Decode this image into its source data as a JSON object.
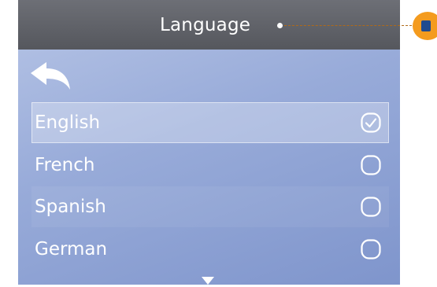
{
  "header": {
    "title": "Language"
  },
  "icons": {
    "back": "back-arrow-icon",
    "checked": "checked-circle-icon",
    "unchecked": "empty-circle-icon",
    "scroll": "scroll-down-triangle-icon"
  },
  "languages": [
    {
      "label": "English",
      "selected": true
    },
    {
      "label": "French",
      "selected": false
    },
    {
      "label": "Spanish",
      "selected": false
    },
    {
      "label": "German",
      "selected": false
    }
  ],
  "colors": {
    "header": "#5e6066",
    "screen_top": "#b7c5e6",
    "screen_bottom": "#7f95cc",
    "callout": "#f49b1e"
  }
}
